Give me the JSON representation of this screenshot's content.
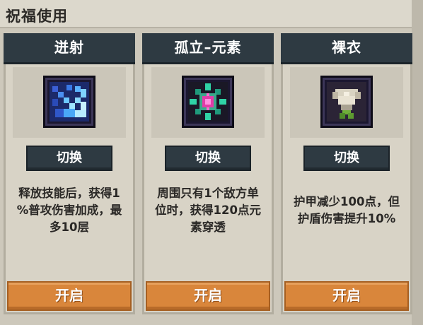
{
  "window": {
    "title": "祝福使用"
  },
  "cards": [
    {
      "name": "迸射",
      "icon": "burst-blessing-icon",
      "switch_label": "切换",
      "description_lines": [
        "释放技能后，获得1",
        "%普攻伤害加成，最",
        "多10层"
      ],
      "open_label": "开启"
    },
    {
      "name": "孤立–元素",
      "icon": "isolation-element-blessing-icon",
      "switch_label": "切换",
      "description_lines": [
        "周围只有1个敌方单",
        "位时，获得120点元",
        "素穿透"
      ],
      "open_label": "开启"
    },
    {
      "name": "裸衣",
      "icon": "bare-armor-blessing-icon",
      "switch_label": "切换",
      "description_lines": [
        "护甲减少100点，但",
        "护盾伤害提升10%"
      ],
      "open_label": "开启"
    }
  ],
  "colors": {
    "header_bg": "#2e3a42",
    "button_orange": "#d9863b",
    "panel_bg": "#d8d3c6"
  }
}
